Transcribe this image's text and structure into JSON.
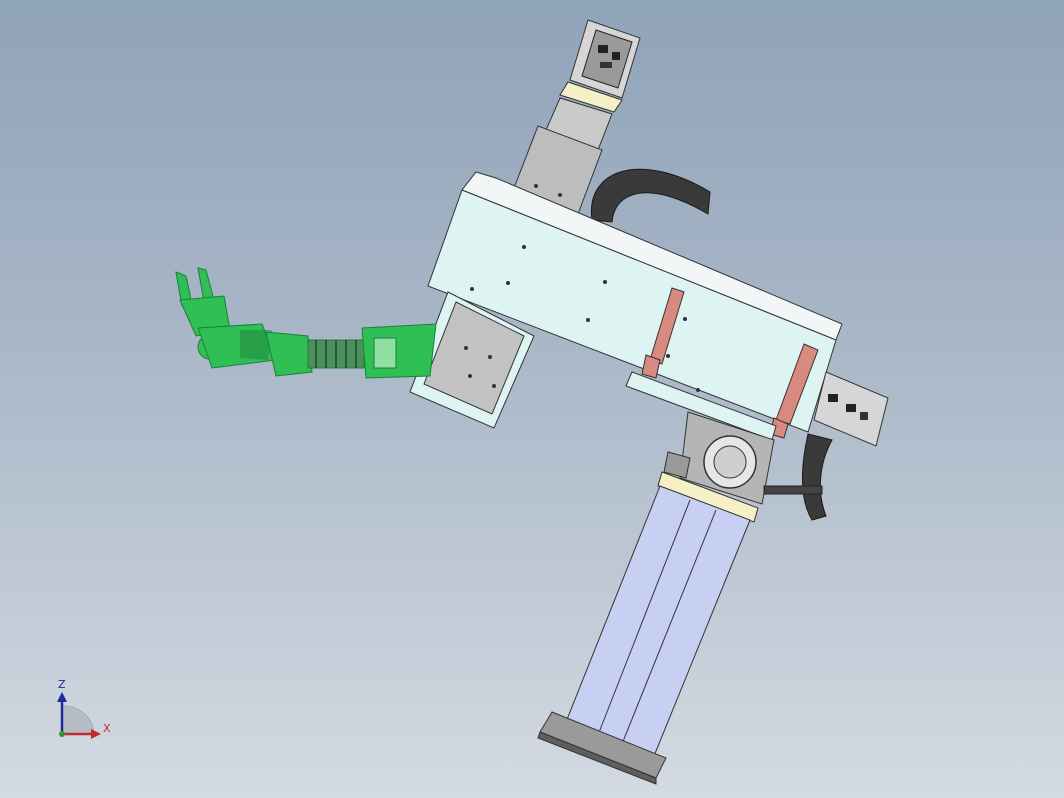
{
  "viewport": {
    "background_top": "#8fa3b9",
    "background_bottom": "#d4dae2"
  },
  "model": {
    "colors": {
      "frame_face": "#ddf4f2",
      "frame_top": "#f2f6f6",
      "gripper": "#2fbf54",
      "gripper_dark": "#1d7f37",
      "bellows": "#4f8f5d",
      "column": "#c7cff2",
      "motor_body": "#bdbdbd",
      "rail": "#d98a80",
      "cable": "#3a3a3a",
      "plate": "#f5f0c6"
    }
  },
  "triad": {
    "z_label": "Z",
    "x_label": "X",
    "z_color": "#1c2a9a",
    "x_color": "#c42a2a",
    "y_color": "#2e9a2e"
  }
}
